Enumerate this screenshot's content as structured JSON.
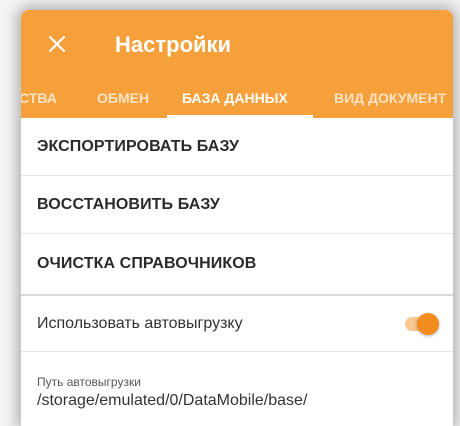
{
  "header": {
    "title": "Настройки",
    "close_icon": "close-icon",
    "accent_color": "#f6a03c"
  },
  "tabs": [
    {
      "label": "СТВА",
      "active": false
    },
    {
      "label": "ОБМЕН",
      "active": false
    },
    {
      "label": "БАЗА ДАННЫХ",
      "active": true
    },
    {
      "label": "ВИД ДОКУМЕНТ",
      "active": false
    }
  ],
  "menu": {
    "export_label": "ЭКСПОРТИРОВАТЬ БАЗУ",
    "restore_label": "ВОССТАНОВИТЬ БАЗУ",
    "clear_label": "ОЧИСТКА СПРАВОЧНИКОВ"
  },
  "auto_upload": {
    "label": "Использовать автовыгрузку",
    "enabled": true
  },
  "upload_path": {
    "label": "Путь автовыгрузки",
    "value": "/storage/emulated/0/DataMobile/base/"
  }
}
